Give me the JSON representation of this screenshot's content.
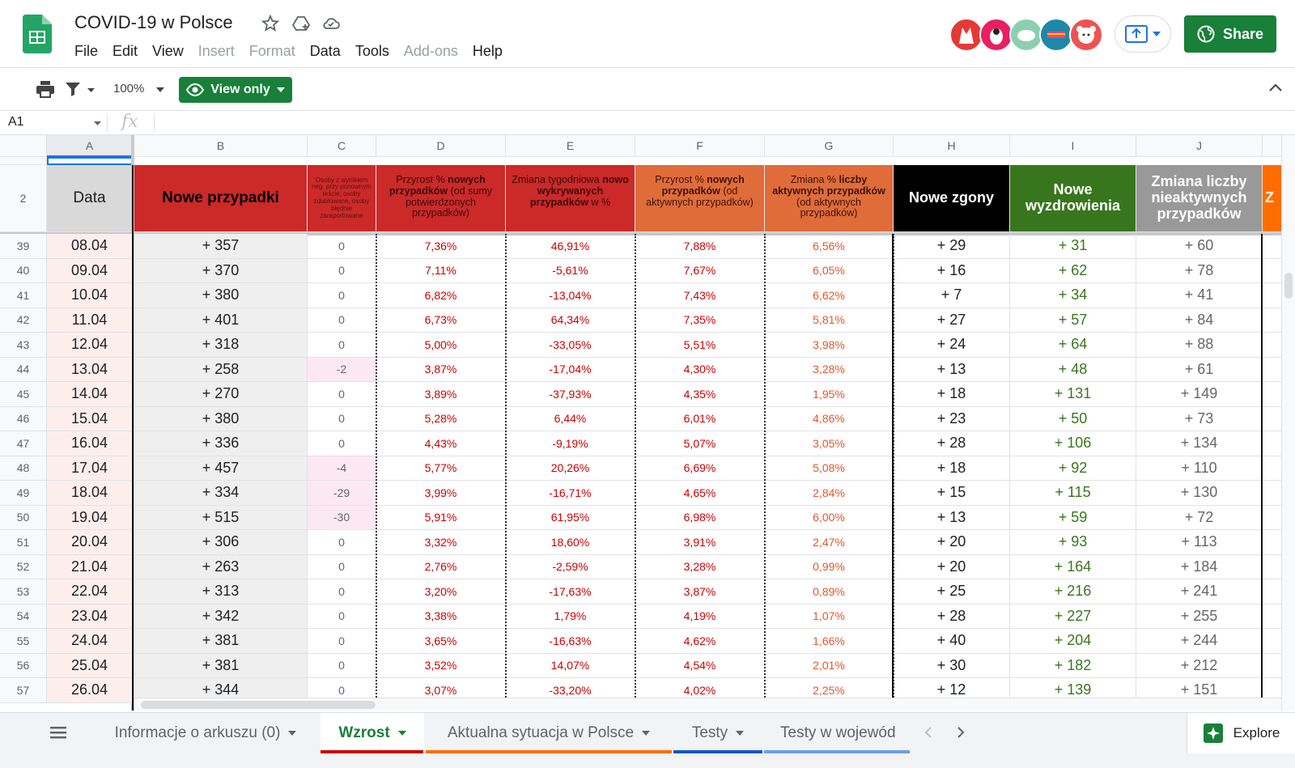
{
  "app": {
    "title": "COVID-19 w Polsce"
  },
  "menu": [
    "File",
    "Edit",
    "View",
    "Insert",
    "Format",
    "Data",
    "Tools",
    "Add-ons",
    "Help"
  ],
  "menu_disabled": [
    "Insert",
    "Format",
    "Add-ons"
  ],
  "share_label": "Share",
  "toolbar": {
    "zoom": "100%",
    "view_only_label": "View only"
  },
  "formula": {
    "cell_ref": "A1",
    "fx": "fx"
  },
  "columns": [
    "A",
    "B",
    "C",
    "D",
    "E",
    "F",
    "G",
    "H",
    "I",
    "J"
  ],
  "header_row_number": "2",
  "headers": {
    "A": "Data",
    "B": "Nowe przypadki",
    "C": "Osoby z wynikiem neg. przy ponownym teście, osoby zdublowane, osoby błędnie zaraportowane",
    "D_parts": [
      "Przyrost % ",
      "nowych przypadków",
      " (od sumy potwierdzonych przypadków)"
    ],
    "E_parts": [
      "Zmiana tygodniowa ",
      "nowo wykrywanych przypadków",
      " w %"
    ],
    "F_parts": [
      "Przyrost % ",
      "nowych przypadków",
      " (od aktywnych przypadków)"
    ],
    "G_parts": [
      "Zmiana % ",
      "liczby aktywnych przypadków",
      " (od aktywnych przypadków)"
    ],
    "H": "Nowe zgony",
    "I": "Nowe wyzdrowienia",
    "J": "Zmiana liczby nieaktywnych przypadków",
    "K": "Z"
  },
  "rows": [
    {
      "n": "39",
      "date": "08.04",
      "b": "+ 357",
      "c": "0",
      "d": "7,36%",
      "e": "46,91%",
      "f": "7,88%",
      "g": "6,56%",
      "h": "+ 29",
      "i": "+ 31",
      "j": "+ 60"
    },
    {
      "n": "40",
      "date": "09.04",
      "b": "+ 370",
      "c": "0",
      "d": "7,11%",
      "e": "-5,61%",
      "f": "7,67%",
      "g": "6,05%",
      "h": "+ 16",
      "i": "+ 62",
      "j": "+ 78"
    },
    {
      "n": "41",
      "date": "10.04",
      "b": "+ 380",
      "c": "0",
      "d": "6,82%",
      "e": "-13,04%",
      "f": "7,43%",
      "g": "6,62%",
      "h": "+ 7",
      "i": "+ 34",
      "j": "+ 41"
    },
    {
      "n": "42",
      "date": "11.04",
      "b": "+ 401",
      "c": "0",
      "d": "6,73%",
      "e": "64,34%",
      "f": "7,35%",
      "g": "5,81%",
      "h": "+ 27",
      "i": "+ 57",
      "j": "+ 84"
    },
    {
      "n": "43",
      "date": "12.04",
      "b": "+ 318",
      "c": "0",
      "d": "5,00%",
      "e": "-33,05%",
      "f": "5,51%",
      "g": "3,98%",
      "h": "+ 24",
      "i": "+ 64",
      "j": "+ 88"
    },
    {
      "n": "44",
      "date": "13.04",
      "b": "+ 258",
      "c": "-2",
      "d": "3,87%",
      "e": "-17,04%",
      "f": "4,30%",
      "g": "3,28%",
      "h": "+ 13",
      "i": "+ 48",
      "j": "+ 61"
    },
    {
      "n": "45",
      "date": "14.04",
      "b": "+ 270",
      "c": "0",
      "d": "3,89%",
      "e": "-37,93%",
      "f": "4,35%",
      "g": "1,95%",
      "h": "+ 18",
      "i": "+ 131",
      "j": "+ 149"
    },
    {
      "n": "46",
      "date": "15.04",
      "b": "+ 380",
      "c": "0",
      "d": "5,28%",
      "e": "6,44%",
      "f": "6,01%",
      "g": "4,86%",
      "h": "+ 23",
      "i": "+ 50",
      "j": "+ 73"
    },
    {
      "n": "47",
      "date": "16.04",
      "b": "+ 336",
      "c": "0",
      "d": "4,43%",
      "e": "-9,19%",
      "f": "5,07%",
      "g": "3,05%",
      "h": "+ 28",
      "i": "+ 106",
      "j": "+ 134"
    },
    {
      "n": "48",
      "date": "17.04",
      "b": "+ 457",
      "c": "-4",
      "d": "5,77%",
      "e": "20,26%",
      "f": "6,69%",
      "g": "5,08%",
      "h": "+ 18",
      "i": "+ 92",
      "j": "+ 110"
    },
    {
      "n": "49",
      "date": "18.04",
      "b": "+ 334",
      "c": "-29",
      "d": "3,99%",
      "e": "-16,71%",
      "f": "4,65%",
      "g": "2,84%",
      "h": "+ 15",
      "i": "+ 115",
      "j": "+ 130"
    },
    {
      "n": "50",
      "date": "19.04",
      "b": "+ 515",
      "c": "-30",
      "d": "5,91%",
      "e": "61,95%",
      "f": "6,98%",
      "g": "6,00%",
      "h": "+ 13",
      "i": "+ 59",
      "j": "+ 72"
    },
    {
      "n": "51",
      "date": "20.04",
      "b": "+ 306",
      "c": "0",
      "d": "3,32%",
      "e": "18,60%",
      "f": "3,91%",
      "g": "2,47%",
      "h": "+ 20",
      "i": "+ 93",
      "j": "+ 113"
    },
    {
      "n": "52",
      "date": "21.04",
      "b": "+ 263",
      "c": "0",
      "d": "2,76%",
      "e": "-2,59%",
      "f": "3,28%",
      "g": "0,99%",
      "h": "+ 20",
      "i": "+ 164",
      "j": "+ 184"
    },
    {
      "n": "53",
      "date": "22.04",
      "b": "+ 313",
      "c": "0",
      "d": "3,20%",
      "e": "-17,63%",
      "f": "3,87%",
      "g": "0,89%",
      "h": "+ 25",
      "i": "+ 216",
      "j": "+ 241"
    },
    {
      "n": "54",
      "date": "23.04",
      "b": "+ 342",
      "c": "0",
      "d": "3,38%",
      "e": "1,79%",
      "f": "4,19%",
      "g": "1,07%",
      "h": "+ 28",
      "i": "+ 227",
      "j": "+ 255"
    },
    {
      "n": "55",
      "date": "24.04",
      "b": "+ 381",
      "c": "0",
      "d": "3,65%",
      "e": "-16,63%",
      "f": "4,62%",
      "g": "1,66%",
      "h": "+ 40",
      "i": "+ 204",
      "j": "+ 244"
    },
    {
      "n": "56",
      "date": "25.04",
      "b": "+ 381",
      "c": "0",
      "d": "3,52%",
      "e": "14,07%",
      "f": "4,54%",
      "g": "2,01%",
      "h": "+ 30",
      "i": "+ 182",
      "j": "+ 212"
    },
    {
      "n": "57",
      "date": "26.04",
      "b": "+ 344",
      "c": "0",
      "d": "3,07%",
      "e": "-33,20%",
      "f": "4,02%",
      "g": "2,25%",
      "h": "+ 12",
      "i": "+ 139",
      "j": "+ 151"
    }
  ],
  "sheet_tabs": [
    {
      "label": "Informacje o arkuszu (0)",
      "active": false
    },
    {
      "label": "Wzrost",
      "active": true
    },
    {
      "label": "Aktualna sytuacja w Polsce",
      "active": false
    },
    {
      "label": "Testy",
      "active": false
    },
    {
      "label": "Testy w wojewód",
      "active": false
    }
  ],
  "explore_label": "Explore",
  "colors": {
    "green": "#188038",
    "header_red": "#cc2929",
    "header_orange": "#e06c3a",
    "header_black": "#000000",
    "header_green": "#38761d",
    "header_gray": "#999999"
  }
}
